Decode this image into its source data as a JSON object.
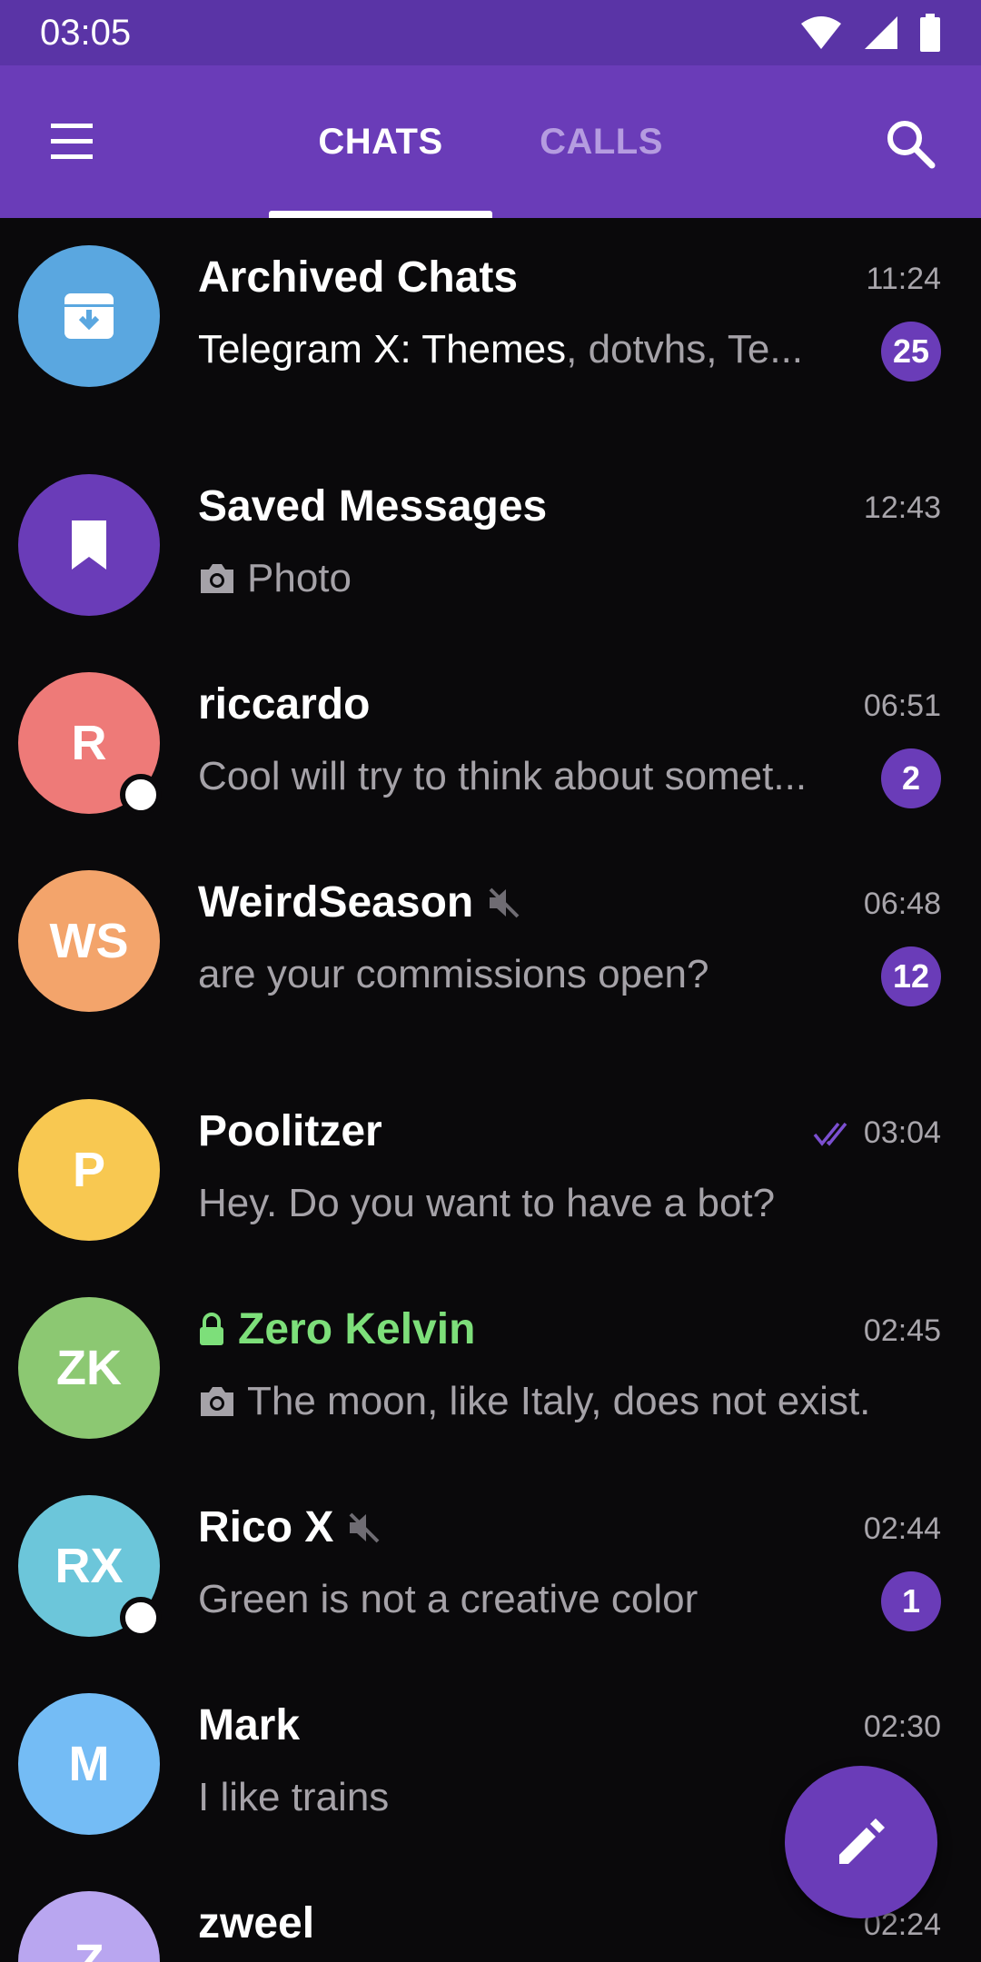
{
  "status_bar": {
    "time": "03:05"
  },
  "app_bar": {
    "tabs": [
      {
        "label": "CHATS",
        "active": true
      },
      {
        "label": "CALLS",
        "active": false
      }
    ]
  },
  "colors": {
    "accent": "#6a3cb8",
    "status_bar": "#5a34a6",
    "background": "#0a090b",
    "secret_chat_green": "#7ddf7a"
  },
  "chats": [
    {
      "name": "Archived Chats",
      "time": "11:24",
      "preview_highlight": "Telegram X: Themes",
      "preview": ", dotvhs, Te...",
      "badge": "25",
      "avatar_icon": "archive-icon",
      "avatar_color": "#5aa7e0"
    },
    {
      "name": "Saved Messages",
      "time": "12:43",
      "preview": "Photo",
      "preview_icon": "camera-icon",
      "avatar_icon": "bookmark-icon",
      "avatar_color": "#6a3cb8"
    },
    {
      "name": "riccardo",
      "time": "06:51",
      "preview": "Cool will try to think about somet...",
      "badge": "2",
      "initials": "R",
      "avatar_color": "#ee7a78",
      "online": true
    },
    {
      "name": "WeirdSeason",
      "time": "06:48",
      "preview": "are your commissions open?",
      "badge": "12",
      "initials": "WS",
      "avatar_color": "#f3a46b",
      "muted": true
    },
    {
      "name": "Poolitzer",
      "time": "03:04",
      "preview": "Hey. Do you want to have a bot?",
      "initials": "P",
      "avatar_color": "#f8c851",
      "read_status": "double-check-icon"
    },
    {
      "name": "Zero Kelvin",
      "time": "02:45",
      "preview": "The moon, like Italy, does not exist.",
      "preview_icon": "camera-icon",
      "initials": "ZK",
      "avatar_color": "#8cc872",
      "secret": true
    },
    {
      "name": "Rico X",
      "time": "02:44",
      "preview": "Green is not a creative color",
      "badge": "1",
      "initials": "RX",
      "avatar_color": "#6cc6da",
      "online": true,
      "muted": true
    },
    {
      "name": "Mark",
      "time": "02:30",
      "preview": "I like trains",
      "initials": "M",
      "avatar_color": "#74bcf5"
    },
    {
      "name": "zweel",
      "time": "02:24",
      "initials": "Z",
      "avatar_color": "#b9a6f0"
    }
  ]
}
